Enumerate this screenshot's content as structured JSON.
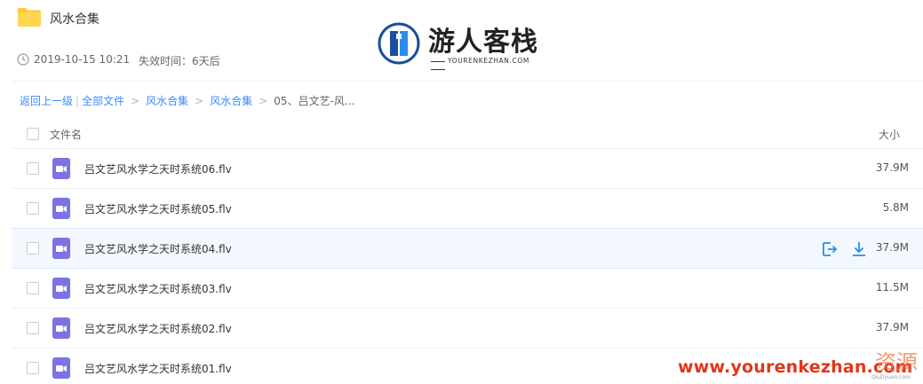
{
  "header": {
    "folder_title": "风水合集",
    "date": "2019-10-15 10:21",
    "expire": "失效时间：6天后"
  },
  "logo": {
    "title": "游人客栈",
    "subtitle": "YOURENKEZHAN.COM"
  },
  "breadcrumb": {
    "back": "返回上一级",
    "all_files": "全部文件",
    "level1": "风水合集",
    "level2": "风水合集",
    "current": "05、吕文艺-风..."
  },
  "table": {
    "col_name": "文件名",
    "col_size": "大小",
    "rows": [
      {
        "name": "吕文艺风水学之天时系统06.flv",
        "size": "37.9M"
      },
      {
        "name": "吕文艺风水学之天时系统05.flv",
        "size": "5.8M"
      },
      {
        "name": "吕文艺风水学之天时系统04.flv",
        "size": "37.9M"
      },
      {
        "name": "吕文艺风水学之天时系统03.flv",
        "size": "11.5M"
      },
      {
        "name": "吕文艺风水学之天时系统02.flv",
        "size": "37.9M"
      },
      {
        "name": "吕文艺风水学之天时系统01.flv",
        "size": ""
      }
    ]
  },
  "watermark": {
    "url": "www.yourenkezhan.com",
    "brand": "资源",
    "sub": "QuZiyuan.com"
  },
  "colors": {
    "accent": "#3b8cff",
    "folder": "#ffc933",
    "video_icon": "#7b73e5",
    "hover_row": "#f3f8ff",
    "watermark": "#e0361c"
  }
}
